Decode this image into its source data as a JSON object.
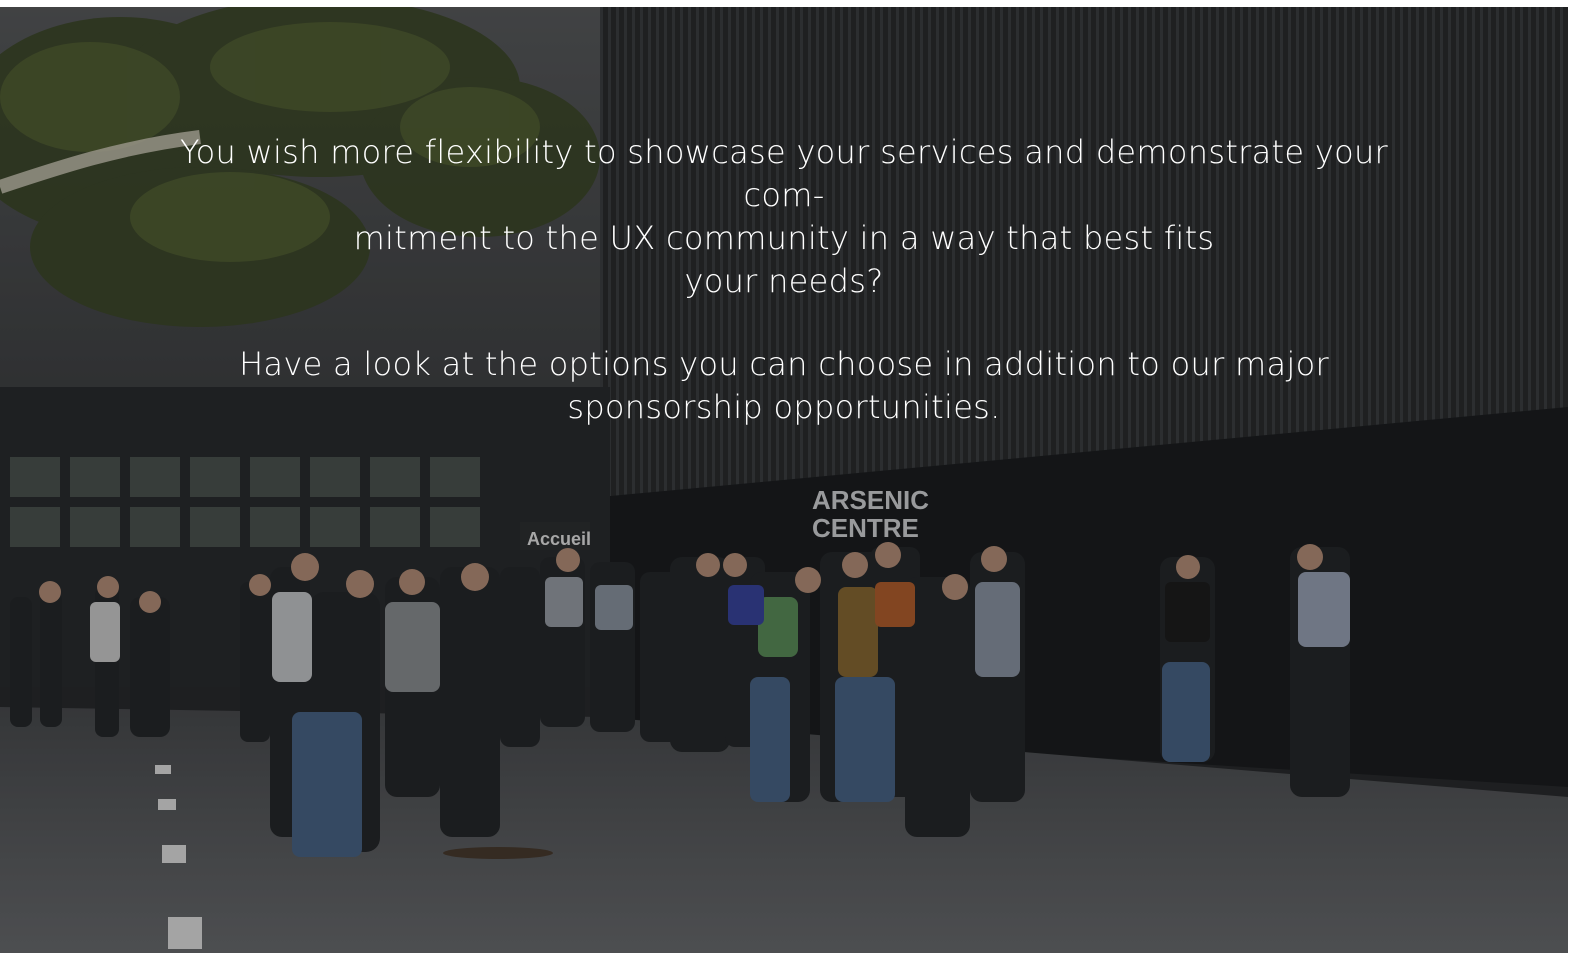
{
  "hero": {
    "paragraph1_lines": [
      "You wish more flexibility to showcase your services and demonstrate your com-",
      "mitment to the UX community in a way that best fits",
      "your needs?"
    ],
    "paragraph2_lines": [
      "Have a look at the options you can choose in addition to our major",
      "sponsorship opportunities."
    ],
    "sign_text": [
      "ARSENIC",
      "CENTRE"
    ],
    "accueil_text": "Accueil"
  },
  "colors": {
    "text": "#ffffff",
    "overlay": "#000000",
    "wall": "#1e2022",
    "ground": "#3b3d40"
  }
}
